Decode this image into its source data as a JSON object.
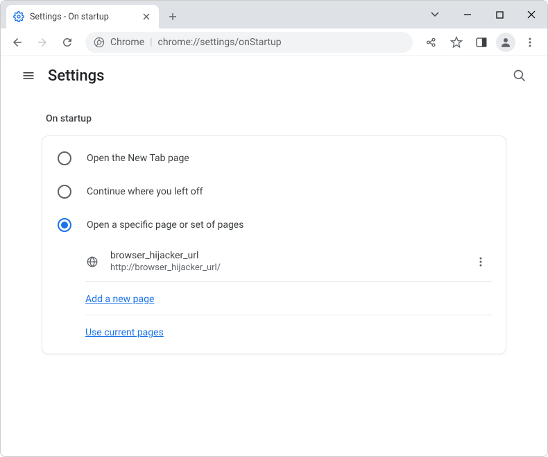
{
  "tab": {
    "title": "Settings - On startup"
  },
  "omnibox": {
    "secure_label": "Chrome",
    "url": "chrome://settings/onStartup"
  },
  "settings": {
    "title": "Settings",
    "section_title": "On startup",
    "options": {
      "open_new_tab": "Open the New Tab page",
      "continue": "Continue where you left off",
      "specific": "Open a specific page or set of pages"
    },
    "pages": [
      {
        "title": "browser_hijacker_url",
        "url": "http://browser_hijacker_url/"
      }
    ],
    "links": {
      "add_page": "Add a new page",
      "use_current": "Use current pages"
    },
    "selected": "specific"
  },
  "colors": {
    "accent": "#1a73e8"
  }
}
